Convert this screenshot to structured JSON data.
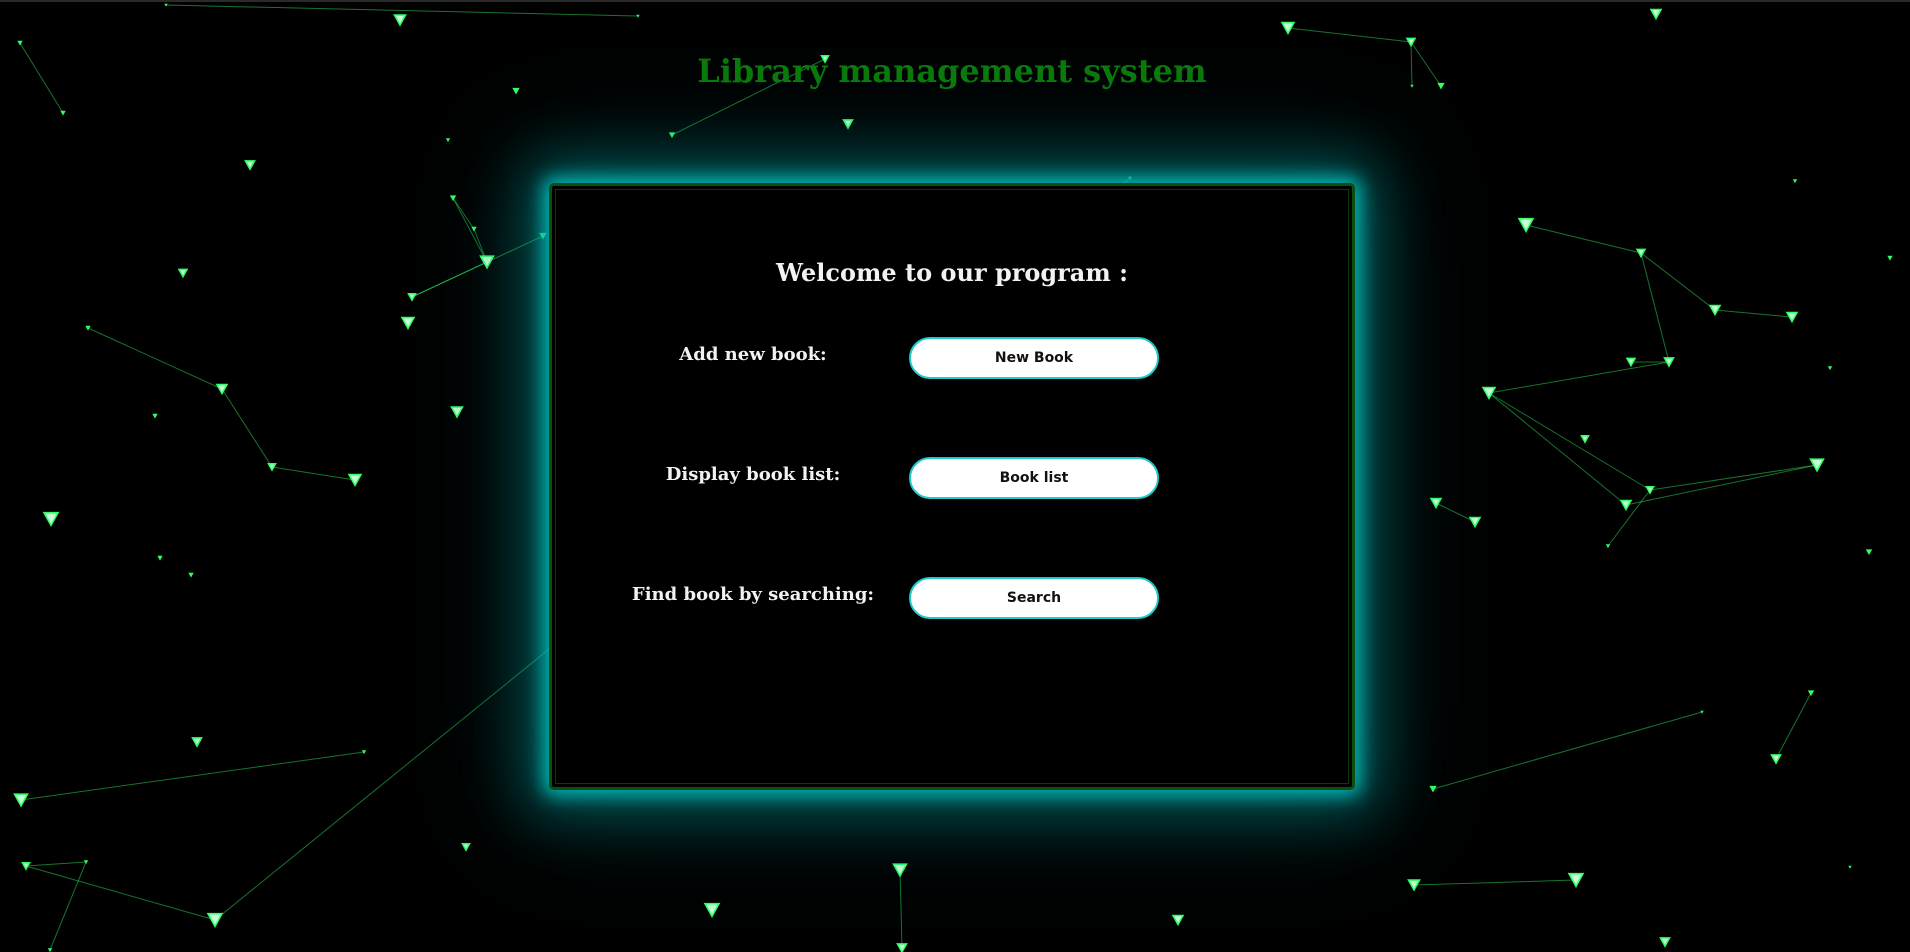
{
  "page": {
    "title": "Library management system"
  },
  "panel": {
    "welcome": "Welcome to our program :",
    "rows": [
      {
        "label": "Add new book:",
        "button": "New Book"
      },
      {
        "label": "Display book list:",
        "button": "Book list"
      },
      {
        "label": "Find book by searching:",
        "button": "Search"
      }
    ]
  },
  "colors": {
    "background": "#000000",
    "title": "#0a7a0a",
    "panel_border": "#0c4f0c",
    "panel_glow": "#00c8c8",
    "button_bg": "#ffffff",
    "button_border": "#21c9c9",
    "particle": "#33ff66"
  },
  "background": {
    "effect": "animated green triangle particles connected by lines"
  }
}
